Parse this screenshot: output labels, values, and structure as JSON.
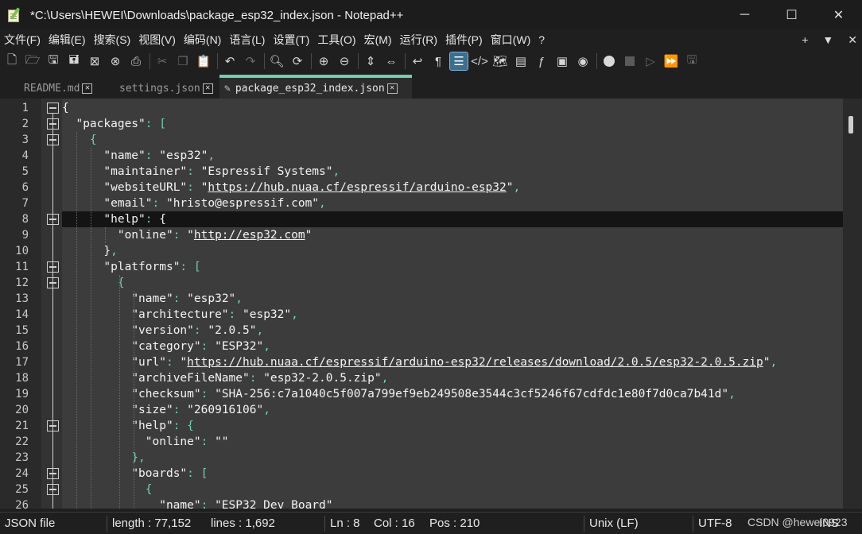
{
  "window": {
    "title": "*C:\\Users\\HEWEI\\Downloads\\package_esp32_index.json - Notepad++",
    "controls": [
      "─",
      "☐",
      "✕"
    ]
  },
  "menu": {
    "items": [
      "文件(F)",
      "编辑(E)",
      "搜索(S)",
      "视图(V)",
      "编码(N)",
      "语言(L)",
      "设置(T)",
      "工具(O)",
      "宏(M)",
      "运行(R)",
      "插件(P)",
      "窗口(W)",
      "?"
    ],
    "right": [
      "+",
      "▼",
      "✕"
    ]
  },
  "toolbar": {
    "icons": [
      "new-file-icon",
      "open-file-icon",
      "save-icon",
      "save-all-icon",
      "close-icon",
      "close-all-icon",
      "print-icon",
      "cut-icon",
      "copy-icon",
      "paste-icon",
      "undo-icon",
      "redo-icon",
      "find-icon",
      "replace-icon",
      "zoom-in-icon",
      "zoom-out-icon",
      "sync-vertical-icon",
      "sync-horizontal-icon",
      "word-wrap-icon",
      "show-all-chars-icon",
      "indent-guide-icon",
      "udl-icon",
      "document-map-icon",
      "document-list-icon",
      "function-list-icon",
      "folder-as-workspace-icon",
      "monitoring-icon",
      "macro-record-icon",
      "macro-stop-icon",
      "macro-play-icon",
      "macro-run-multiple-icon",
      "macro-save-icon"
    ]
  },
  "tabs": [
    {
      "label": "README.md",
      "active": false
    },
    {
      "label": "settings.json",
      "active": false
    },
    {
      "label": "package_esp32_index.json",
      "active": true
    }
  ],
  "editor": {
    "current_line": 8,
    "lines": [
      {
        "n": "1",
        "fold": true,
        "segs": [
          [
            "brace",
            "{"
          ]
        ]
      },
      {
        "n": "2",
        "fold": true,
        "segs": [
          [
            "txt",
            "  "
          ],
          [
            "key",
            "\"packages\""
          ],
          [
            "punc",
            ": ["
          ]
        ]
      },
      {
        "n": "3",
        "fold": true,
        "segs": [
          [
            "txt",
            "    "
          ],
          [
            "punc",
            "{"
          ]
        ]
      },
      {
        "n": "4",
        "fold": false,
        "segs": [
          [
            "txt",
            "      "
          ],
          [
            "key",
            "\"name\""
          ],
          [
            "punc",
            ": "
          ],
          [
            "str",
            "\"esp32\""
          ],
          [
            "punc",
            ","
          ]
        ]
      },
      {
        "n": "5",
        "fold": false,
        "segs": [
          [
            "txt",
            "      "
          ],
          [
            "key",
            "\"maintainer\""
          ],
          [
            "punc",
            ": "
          ],
          [
            "str",
            "\"Espressif Systems\""
          ],
          [
            "punc",
            ","
          ]
        ]
      },
      {
        "n": "6",
        "fold": false,
        "segs": [
          [
            "txt",
            "      "
          ],
          [
            "key",
            "\"websiteURL\""
          ],
          [
            "punc",
            ": "
          ],
          [
            "str",
            "\""
          ],
          [
            "url",
            "https://hub.nuaa.cf/espressif/arduino-esp32"
          ],
          [
            "str",
            "\""
          ],
          [
            "punc",
            ","
          ]
        ]
      },
      {
        "n": "7",
        "fold": false,
        "segs": [
          [
            "txt",
            "      "
          ],
          [
            "key",
            "\"email\""
          ],
          [
            "punc",
            ": "
          ],
          [
            "str",
            "\"hristo@espressif.com\""
          ],
          [
            "punc",
            ","
          ]
        ]
      },
      {
        "n": "8",
        "fold": true,
        "segs": [
          [
            "txt",
            "      "
          ],
          [
            "key",
            "\"help\""
          ],
          [
            "punc",
            ": "
          ],
          [
            "brace",
            "{"
          ]
        ]
      },
      {
        "n": "9",
        "fold": false,
        "segs": [
          [
            "txt",
            "        "
          ],
          [
            "key",
            "\"online\""
          ],
          [
            "punc",
            ": "
          ],
          [
            "str",
            "\""
          ],
          [
            "url",
            "http://esp32.com"
          ],
          [
            "str",
            "\""
          ]
        ]
      },
      {
        "n": "10",
        "fold": false,
        "segs": [
          [
            "txt",
            "      "
          ],
          [
            "brace",
            "}"
          ],
          [
            "punc",
            ","
          ]
        ]
      },
      {
        "n": "11",
        "fold": true,
        "segs": [
          [
            "txt",
            "      "
          ],
          [
            "key",
            "\"platforms\""
          ],
          [
            "punc",
            ": ["
          ]
        ]
      },
      {
        "n": "12",
        "fold": true,
        "segs": [
          [
            "txt",
            "        "
          ],
          [
            "punc",
            "{"
          ]
        ]
      },
      {
        "n": "13",
        "fold": false,
        "segs": [
          [
            "txt",
            "          "
          ],
          [
            "key",
            "\"name\""
          ],
          [
            "punc",
            ": "
          ],
          [
            "str",
            "\"esp32\""
          ],
          [
            "punc",
            ","
          ]
        ]
      },
      {
        "n": "14",
        "fold": false,
        "segs": [
          [
            "txt",
            "          "
          ],
          [
            "key",
            "\"architecture\""
          ],
          [
            "punc",
            ": "
          ],
          [
            "str",
            "\"esp32\""
          ],
          [
            "punc",
            ","
          ]
        ]
      },
      {
        "n": "15",
        "fold": false,
        "segs": [
          [
            "txt",
            "          "
          ],
          [
            "key",
            "\"version\""
          ],
          [
            "punc",
            ": "
          ],
          [
            "str",
            "\"2.0.5\""
          ],
          [
            "punc",
            ","
          ]
        ]
      },
      {
        "n": "16",
        "fold": false,
        "segs": [
          [
            "txt",
            "          "
          ],
          [
            "key",
            "\"category\""
          ],
          [
            "punc",
            ": "
          ],
          [
            "str",
            "\"ESP32\""
          ],
          [
            "punc",
            ","
          ]
        ]
      },
      {
        "n": "17",
        "fold": false,
        "segs": [
          [
            "txt",
            "          "
          ],
          [
            "key",
            "\"url\""
          ],
          [
            "punc",
            ": "
          ],
          [
            "str",
            "\""
          ],
          [
            "url",
            "https://hub.nuaa.cf/espressif/arduino-esp32/releases/download/2.0.5/esp32-2.0.5.zip"
          ],
          [
            "str",
            "\""
          ],
          [
            "punc",
            ","
          ]
        ]
      },
      {
        "n": "18",
        "fold": false,
        "segs": [
          [
            "txt",
            "          "
          ],
          [
            "key",
            "\"archiveFileName\""
          ],
          [
            "punc",
            ": "
          ],
          [
            "str",
            "\"esp32-2.0.5.zip\""
          ],
          [
            "punc",
            ","
          ]
        ]
      },
      {
        "n": "19",
        "fold": false,
        "segs": [
          [
            "txt",
            "          "
          ],
          [
            "key",
            "\"checksum\""
          ],
          [
            "punc",
            ": "
          ],
          [
            "str",
            "\"SHA-256:c7a1040c5f007a799ef9eb249508e3544c3cf5246f67cdfdc1e80f7d0ca7b41d\""
          ],
          [
            "punc",
            ","
          ]
        ]
      },
      {
        "n": "20",
        "fold": false,
        "segs": [
          [
            "txt",
            "          "
          ],
          [
            "key",
            "\"size\""
          ],
          [
            "punc",
            ": "
          ],
          [
            "str",
            "\"260916106\""
          ],
          [
            "punc",
            ","
          ]
        ]
      },
      {
        "n": "21",
        "fold": true,
        "segs": [
          [
            "txt",
            "          "
          ],
          [
            "key",
            "\"help\""
          ],
          [
            "punc",
            ": {"
          ]
        ]
      },
      {
        "n": "22",
        "fold": false,
        "segs": [
          [
            "txt",
            "            "
          ],
          [
            "key",
            "\"online\""
          ],
          [
            "punc",
            ": "
          ],
          [
            "str",
            "\"\""
          ]
        ]
      },
      {
        "n": "23",
        "fold": false,
        "segs": [
          [
            "txt",
            "          "
          ],
          [
            "punc",
            "},"
          ]
        ]
      },
      {
        "n": "24",
        "fold": true,
        "segs": [
          [
            "txt",
            "          "
          ],
          [
            "key",
            "\"boards\""
          ],
          [
            "punc",
            ": ["
          ]
        ]
      },
      {
        "n": "25",
        "fold": true,
        "segs": [
          [
            "txt",
            "            "
          ],
          [
            "punc",
            "{"
          ]
        ]
      },
      {
        "n": "26",
        "fold": false,
        "segs": [
          [
            "txt",
            "              "
          ],
          [
            "key",
            "\"name\""
          ],
          [
            "punc",
            ": "
          ],
          [
            "str",
            "\"ESP32 Dev Board\""
          ]
        ]
      }
    ]
  },
  "status": {
    "file_type": "JSON file",
    "length": "length : 77,152",
    "lines": "lines : 1,692",
    "ln": "Ln : 8",
    "col": "Col : 16",
    "pos": "Pos : 210",
    "eol": "Unix (LF)",
    "encoding": "UTF-8",
    "ins": "INS",
    "watermark": "CSDN @hewei0923"
  }
}
